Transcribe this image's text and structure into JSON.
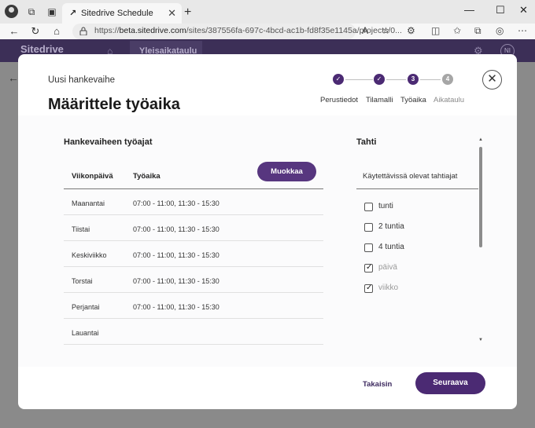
{
  "browser": {
    "tab_title": "Sitedrive Schedule",
    "url_prefix": "https://",
    "url_host": "beta.sitedrive.com",
    "url_path": "/sites/387556fa-697c-4bcd-ac1b-fd8f35e1145a/projects/0..."
  },
  "app": {
    "logo": "Sitedrive",
    "breadcrumb": "Yleisaikataulu",
    "user_initials": "NI"
  },
  "modal": {
    "subtitle": "Uusi hankevaihe",
    "title": "Määrittele työaika",
    "steps": [
      {
        "label": "Perustiedot",
        "state": "done",
        "number": "1"
      },
      {
        "label": "Tilamalli",
        "state": "done",
        "number": "2"
      },
      {
        "label": "Työaika",
        "state": "active",
        "number": "3"
      },
      {
        "label": "Aikataulu",
        "state": "todo",
        "number": "4"
      }
    ],
    "worktime": {
      "title": "Hankevaiheen työajat",
      "edit_label": "Muokkaa",
      "col_day": "Viikonpäivä",
      "col_time": "Työaika",
      "rows": [
        {
          "day": "Maanantai",
          "time": "07:00 - 11:00, 11:30 - 15:30"
        },
        {
          "day": "Tiistai",
          "time": "07:00 - 11:00, 11:30 - 15:30"
        },
        {
          "day": "Keskiviikko",
          "time": "07:00 - 11:00, 11:30 - 15:30"
        },
        {
          "day": "Torstai",
          "time": "07:00 - 11:00, 11:30 - 15:30"
        },
        {
          "day": "Perjantai",
          "time": "07:00 - 11:00, 11:30 - 15:30"
        },
        {
          "day": "Lauantai",
          "time": ""
        }
      ]
    },
    "tahti": {
      "title": "Tahti",
      "subtitle": "Käytettävissä olevat tahtiajat",
      "options": [
        {
          "label": "tunti",
          "checked": false,
          "dim": false
        },
        {
          "label": "2 tuntia",
          "checked": false,
          "dim": false
        },
        {
          "label": "4 tuntia",
          "checked": false,
          "dim": false
        },
        {
          "label": "päivä",
          "checked": true,
          "dim": true
        },
        {
          "label": "viikko",
          "checked": true,
          "dim": true
        }
      ]
    },
    "back_label": "Takaisin",
    "next_label": "Seuraava"
  },
  "colors": {
    "brand_dark": "#4b2a73",
    "button": "#57367f",
    "header": "#3c2f57"
  }
}
